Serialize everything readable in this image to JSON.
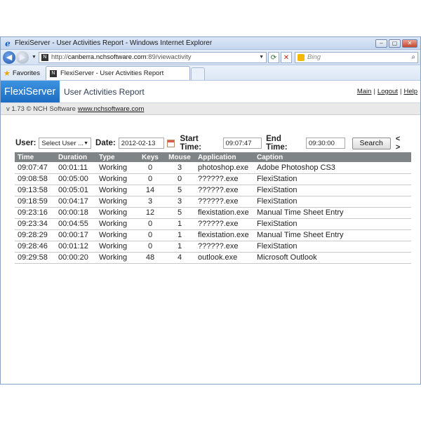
{
  "window": {
    "title": "FlexiServer - User Activities Report - Windows Internet Explorer",
    "buttons": {
      "minimize": "‒",
      "maximize": "▢",
      "close": "✕"
    }
  },
  "addressbar": {
    "url_scheme": "http://",
    "url_host": "canberra.nchsoftware.com",
    "url_path": ":89/viewactivity",
    "search_placeholder": "Bing"
  },
  "favorites": {
    "label": "Favorites",
    "tab_title": "FlexiServer - User Activities Report"
  },
  "app": {
    "brand": "FlexiServer",
    "report_title": "User Activities Report",
    "links": [
      "Main",
      "Logout",
      "Help"
    ],
    "version_text": "v 1.73 © NCH Software",
    "version_link": "www.nchsoftware.com"
  },
  "filters": {
    "user_label": "User:",
    "user_value": "Select User ...",
    "date_label": "Date:",
    "date_value": "2012-02-13",
    "start_label": "Start Time:",
    "start_value": "09:07:47",
    "end_label": "End Time:",
    "end_value": "09:30:00",
    "search_button": "Search",
    "nav_arrows": "< >"
  },
  "table": {
    "columns": [
      "Time",
      "Duration",
      "Type",
      "Keys",
      "Mouse",
      "Application",
      "Caption"
    ],
    "rows": [
      [
        "09:07:47",
        "00:01:11",
        "Working",
        "0",
        "3",
        "photoshop.exe",
        "Adobe Photoshop CS3"
      ],
      [
        "09:08:58",
        "00:05:00",
        "Working",
        "0",
        "0",
        "??????.exe",
        "FlexiStation"
      ],
      [
        "09:13:58",
        "00:05:01",
        "Working",
        "14",
        "5",
        "??????.exe",
        "FlexiStation"
      ],
      [
        "09:18:59",
        "00:04:17",
        "Working",
        "3",
        "3",
        "??????.exe",
        "FlexiStation"
      ],
      [
        "09:23:16",
        "00:00:18",
        "Working",
        "12",
        "5",
        "flexistation.exe",
        "Manual Time Sheet Entry"
      ],
      [
        "09:23:34",
        "00:04:55",
        "Working",
        "0",
        "1",
        "??????.exe",
        "FlexiStation"
      ],
      [
        "09:28:29",
        "00:00:17",
        "Working",
        "0",
        "1",
        "flexistation.exe",
        "Manual Time Sheet Entry"
      ],
      [
        "09:28:46",
        "00:01:12",
        "Working",
        "0",
        "1",
        "??????.exe",
        "FlexiStation"
      ],
      [
        "09:29:58",
        "00:00:20",
        "Working",
        "48",
        "4",
        "outlook.exe",
        "Microsoft Outlook"
      ]
    ]
  }
}
